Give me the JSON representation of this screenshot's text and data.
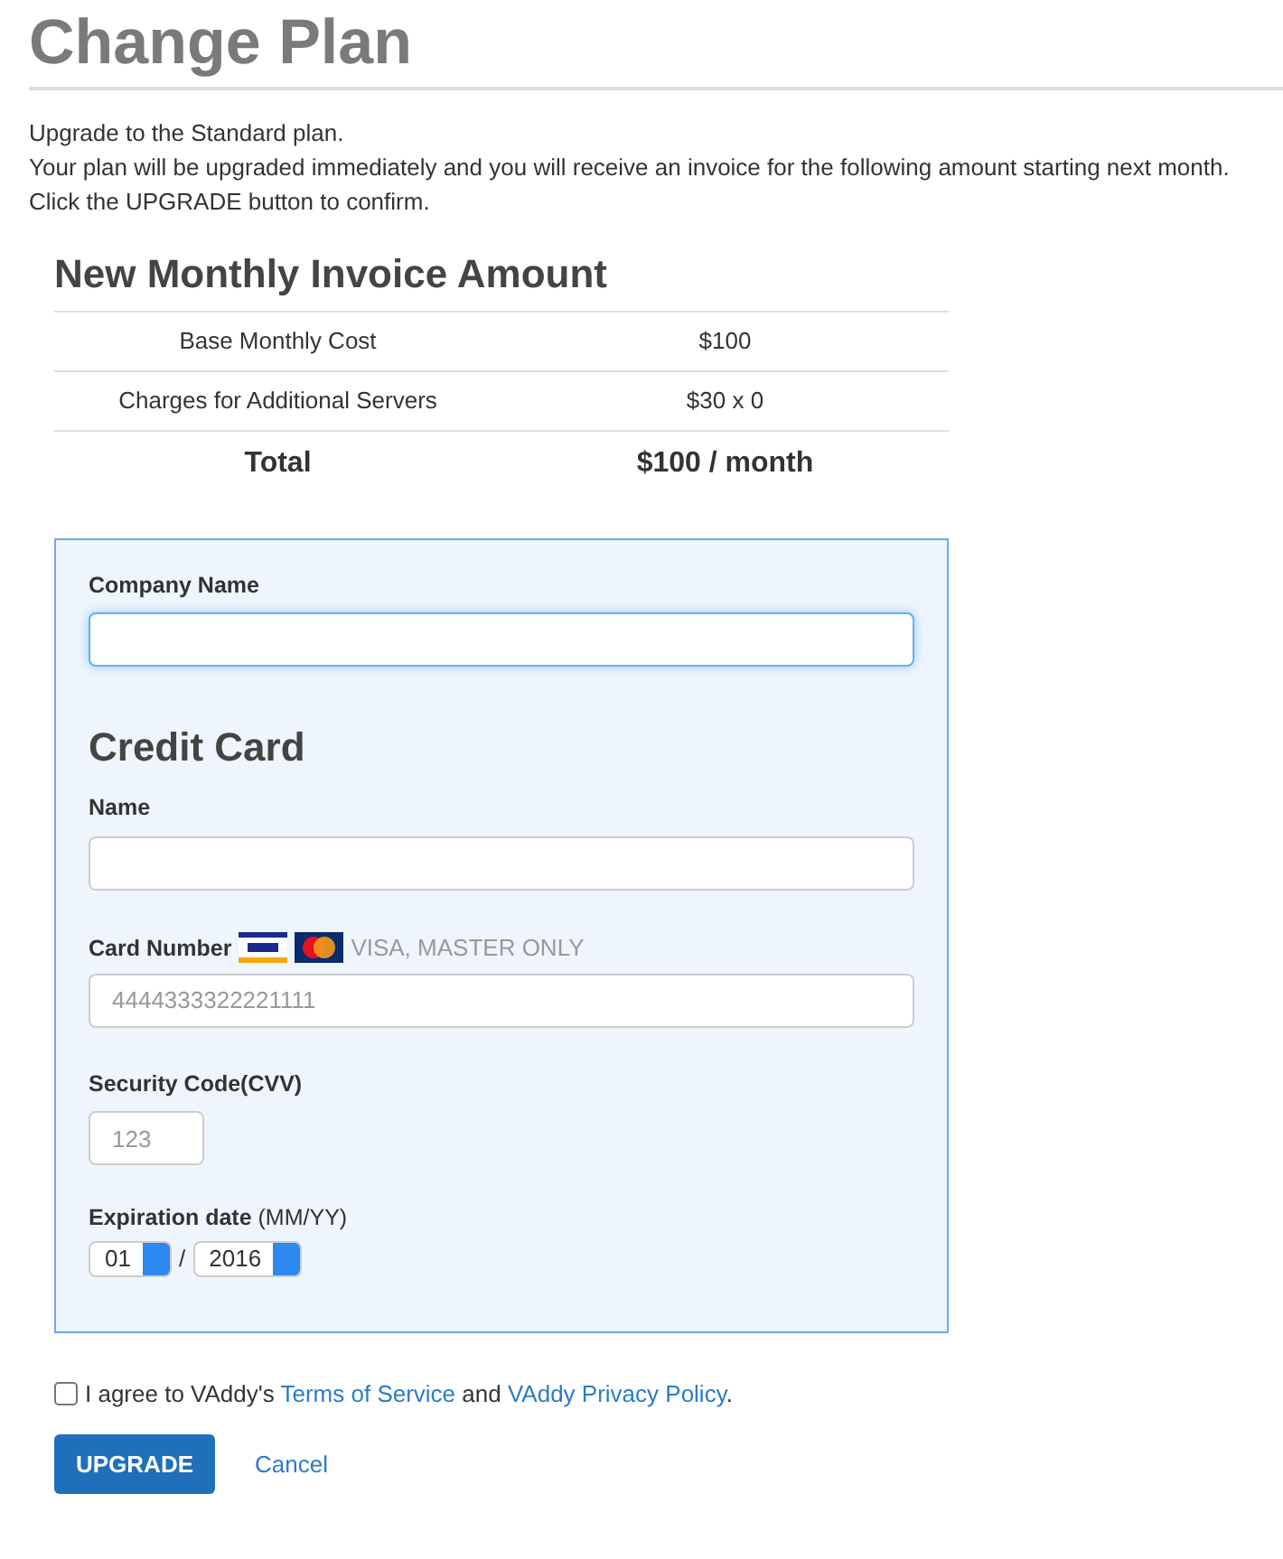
{
  "title": "Change Plan",
  "intro": [
    "Upgrade to the Standard plan.",
    "Your plan will be upgraded immediately and you will receive an invoice for the following amount starting next month.",
    "Click the UPGRADE button to confirm."
  ],
  "invoice": {
    "title": "New Monthly Invoice Amount",
    "rows": [
      {
        "label": "Base Monthly Cost",
        "value": "$100",
        "kind": "item"
      },
      {
        "label": "Charges for Additional Servers",
        "value": "$30 x 0",
        "kind": "item"
      },
      {
        "label": "Total",
        "value": "$100 / month",
        "kind": "total"
      }
    ]
  },
  "form": {
    "company": {
      "label": "Company Name",
      "focused": true
    },
    "card_title": "Credit Card",
    "name": {
      "label": "Name"
    },
    "card_number": {
      "label": "Card Number",
      "note": "VISA, MASTER ONLY",
      "placeholder": "4444333322221111"
    },
    "cvv": {
      "label": "Security Code(CVV)",
      "placeholder": "123"
    },
    "expiration": {
      "label": "**Expiration date** (MM/YY)",
      "month": "01",
      "separator": "/",
      "year": "2016"
    }
  },
  "agreement": {
    "checked": false,
    "before": "I agree to VAddy's",
    "link1": "Terms of Service",
    "middle": "and",
    "link2": "VAddy Privacy Policy",
    "after": "."
  },
  "buttons": {
    "upgrade": "UPGRADE",
    "cancel": "Cancel"
  }
}
